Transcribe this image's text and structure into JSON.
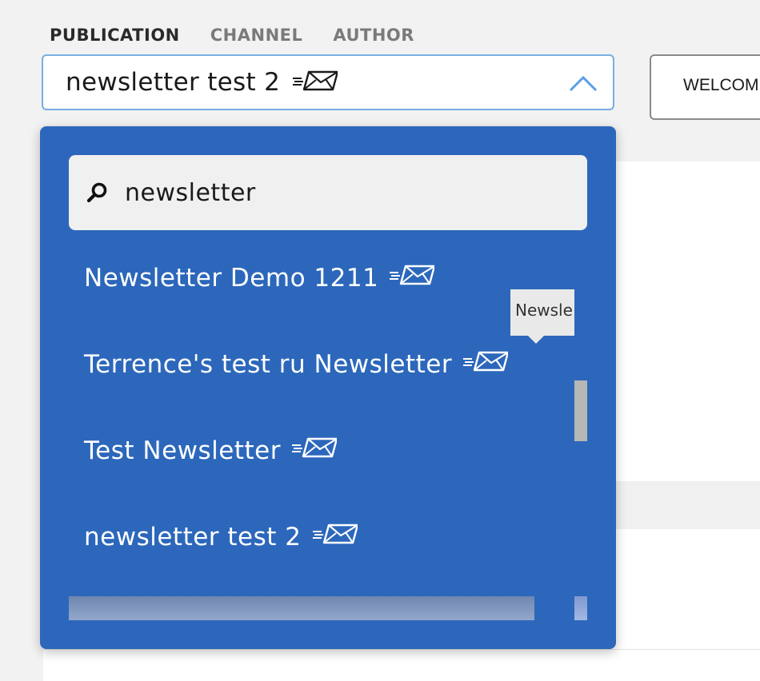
{
  "tabs": [
    {
      "label": "PUBLICATION",
      "active": true
    },
    {
      "label": "CHANNEL",
      "active": false
    },
    {
      "label": "AUTHOR",
      "active": false
    }
  ],
  "select": {
    "value": "newsletter test 2",
    "icon": "newsletter-envelope-icon",
    "open": true
  },
  "welcome_button": {
    "label": "WELCOM"
  },
  "dropdown": {
    "search_placeholder": "",
    "search_value": "newsletter",
    "options": [
      {
        "label": "Newsletter Demo 1211",
        "icon": "newsletter-envelope-icon"
      },
      {
        "label": "Terrence's test ru Newsletter",
        "icon": "newsletter-envelope-icon"
      },
      {
        "label": "Test Newsletter",
        "icon": "newsletter-envelope-icon"
      },
      {
        "label": "newsletter test 2",
        "icon": "newsletter-envelope-icon"
      }
    ],
    "tooltip": "Newsle"
  },
  "colors": {
    "dropdown_bg": "#2c67bb",
    "focus_border": "#78aee2",
    "page_bg": "#f2f2f2"
  }
}
